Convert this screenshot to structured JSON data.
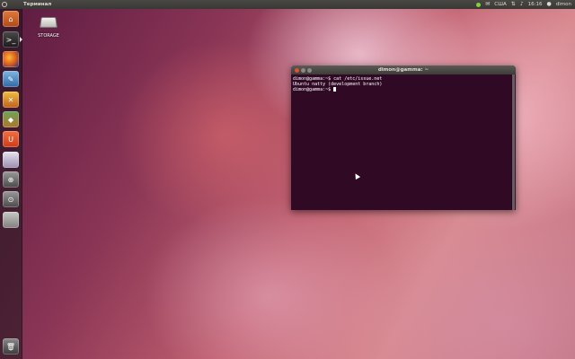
{
  "top_panel": {
    "app_title": "Терминал",
    "keyboard_layout": "США",
    "time": "16:16",
    "user": "dimon"
  },
  "launcher": {
    "items": [
      {
        "name": "home-folder"
      },
      {
        "name": "terminal",
        "active": true
      },
      {
        "name": "firefox"
      },
      {
        "name": "libreoffice-writer"
      },
      {
        "name": "game"
      },
      {
        "name": "ubuntu-software-center"
      },
      {
        "name": "ubuntu-one"
      },
      {
        "name": "workspace-switcher"
      },
      {
        "name": "applications-lens"
      },
      {
        "name": "files-lens"
      },
      {
        "name": "storage-drive"
      },
      {
        "name": "trash"
      }
    ]
  },
  "desktop": {
    "icons": [
      {
        "label": "STORAGE"
      }
    ]
  },
  "terminal_window": {
    "title": "dimon@gamma: ~",
    "lines": [
      "dimon@gamma:~$ cat /etc/issue.net",
      "Ubuntu natty (development branch)",
      "dimon@gamma:~$ "
    ]
  }
}
